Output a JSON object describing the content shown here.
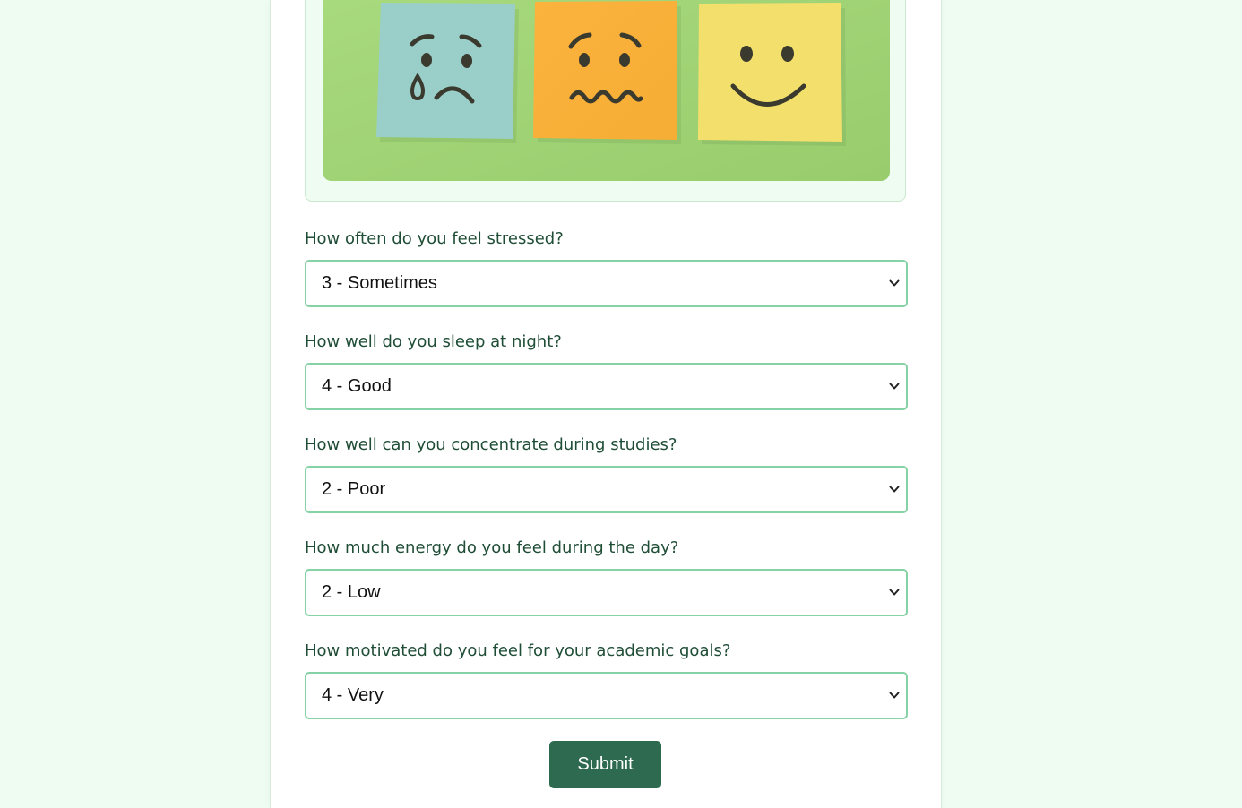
{
  "hero": {
    "image_description_icon": "mood-sticky-notes-image",
    "colors": {
      "background": "#a3d67a",
      "sad_note": "#9acfc9",
      "anxious_note": "#fbb13c",
      "happy_note": "#f3df6b",
      "face_ink": "#3a3a2e"
    }
  },
  "questions": [
    {
      "label": "How often do you feel stressed?",
      "selected": "3 - Sometimes"
    },
    {
      "label": "How well do you sleep at night?",
      "selected": "4 - Good"
    },
    {
      "label": "How well can you concentrate during studies?",
      "selected": "2 - Poor"
    },
    {
      "label": "How much energy do you feel during the day?",
      "selected": "2 - Low"
    },
    {
      "label": "How motivated do you feel for your academic goals?",
      "selected": "4 - Very"
    }
  ],
  "form": {
    "submit_label": "Submit"
  },
  "theme": {
    "page_background": "#effcf2",
    "label_color": "#1f4d36",
    "select_border": "#87d2a5",
    "button_color": "#2d6a4f"
  }
}
